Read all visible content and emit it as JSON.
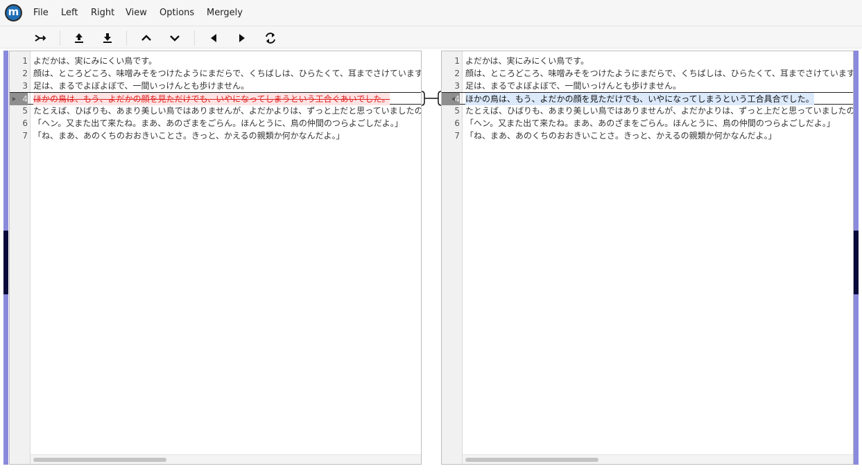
{
  "app": {
    "logo_letter": "m"
  },
  "menu": [
    "File",
    "Left",
    "Right",
    "View",
    "Options",
    "Mergely"
  ],
  "toolbar": {
    "buttons": [
      "merge-arrow-icon",
      "upload-icon",
      "download-icon",
      "chevron-up-icon",
      "chevron-down-icon",
      "arrow-left-icon",
      "arrow-right-icon",
      "swap-icon"
    ]
  },
  "left_pane": {
    "lines": [
      {
        "num": "1",
        "text": "よだかは、実にみにくい鳥です。",
        "state": "normal"
      },
      {
        "num": "2",
        "text": " 顔は、ところどころ、味噌みそをつけたようにまだらで、くちばしは、ひらたくて、耳までさけています。",
        "state": "normal"
      },
      {
        "num": "3",
        "text": " 足は、まるでよぼよぼで、一間いっけんとも歩けません。",
        "state": "normal"
      },
      {
        "num": "4",
        "text": " ほかの鳥は、もう、よだかの顔を見ただけでも、いやになってしまうという工合ぐあいでした。",
        "state": "deleted"
      },
      {
        "num": "5",
        "text": " たとえば、ひばりも、あまり美しい鳥ではありませんが、よだかよりは、ずっと上だと思っていましたので、夕",
        "state": "normal"
      },
      {
        "num": "6",
        "text": "「ヘン。又また出て来たね。まあ、あのざまをごらん。ほんとうに、鳥の仲間のつらよごしだよ。」",
        "state": "normal"
      },
      {
        "num": "7",
        "text": "「ね、まあ、あのくちのおおきいことさ。きっと、かえるの親類か何かなんだよ。」",
        "state": "normal"
      }
    ]
  },
  "right_pane": {
    "lines": [
      {
        "num": "1",
        "text": "よだかは、実にみにくい鳥です。",
        "state": "normal"
      },
      {
        "num": "2",
        "text": " 顔は、ところどころ、味噌みそをつけたようにまだらで、くちばしは、ひらたくて、耳までさけています。",
        "state": "normal"
      },
      {
        "num": "3",
        "text": " 足は、まるでよぼよぼで、一間いっけんとも歩けません。",
        "state": "normal"
      },
      {
        "num": "4",
        "text": " ほかの鳥は、もう、よだかの顔を見ただけでも、いやになってしまうという工合具合でした。",
        "state": "inserted"
      },
      {
        "num": "5",
        "text": " たとえば、ひばりも、あまり美しい鳥ではありませんが、よだかよりは、ずっと上だと思っていましたので、夕",
        "state": "normal"
      },
      {
        "num": "6",
        "text": "「ヘン。又また出て来たね。まあ、あのざまをごらん。ほんとうに、鳥の仲間のつらよごしだよ。」",
        "state": "normal"
      },
      {
        "num": "7",
        "text": "「ね、まあ、あのくちのおおきいことさ。きっと、かえるの親類か何かなんだよ。」",
        "state": "normal"
      }
    ]
  },
  "colors": {
    "accent": "#8a8add",
    "deleted_text": "#e02020",
    "deleted_bg": "#fde3e3",
    "inserted_bg": "#dbe9fb"
  }
}
